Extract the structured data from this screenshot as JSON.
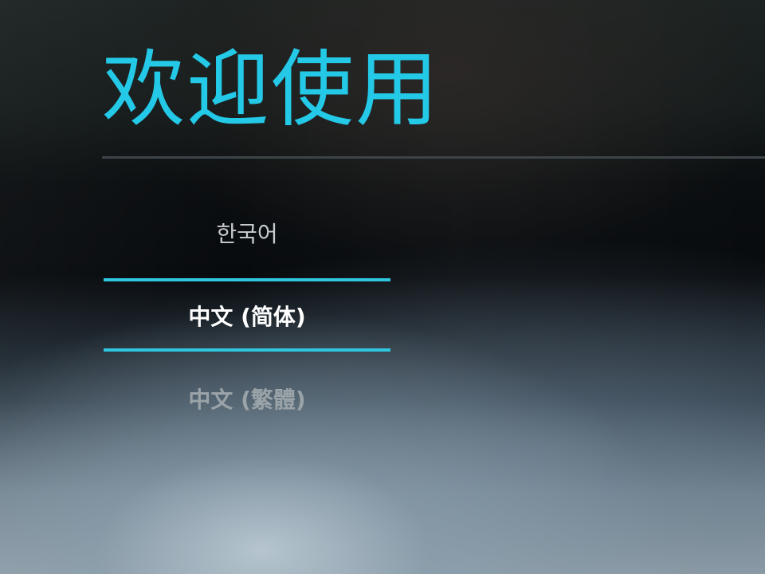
{
  "header": {
    "title": "欢迎使用"
  },
  "language_picker": {
    "items": [
      {
        "label": "한국어",
        "selected": false
      },
      {
        "label": "中文 (简体)",
        "selected": true
      },
      {
        "label": "中文 (繁體)",
        "selected": false
      }
    ]
  },
  "colors": {
    "accent": "#23c9e6",
    "selector": "#2fc6e0",
    "divider": "#3c4447"
  }
}
